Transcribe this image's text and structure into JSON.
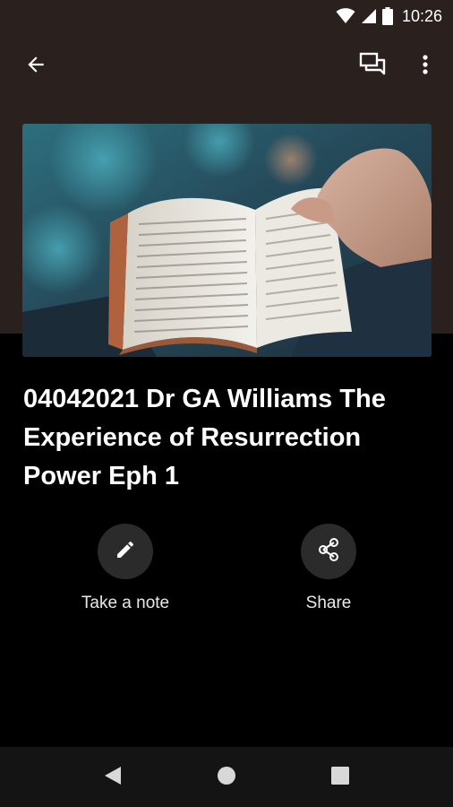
{
  "status_bar": {
    "time": "10:26",
    "icons": [
      "wifi-icon",
      "cellular-signal-icon",
      "battery-icon"
    ]
  },
  "toolbar": {
    "back_icon": "arrow-back-icon",
    "chat_icon": "chat-bubbles-icon",
    "more_icon": "more-vert-icon"
  },
  "episode": {
    "title": "04042021 Dr GA Williams The Experience of Resurrection Power Eph 1",
    "artwork_description_icon": "open-bible-artwork"
  },
  "actions": [
    {
      "label": "Take a note",
      "icon": "pencil-icon"
    },
    {
      "label": "Share",
      "icon": "share-icon"
    }
  ],
  "nav_bar": {
    "icons": [
      "nav-back-icon",
      "nav-home-icon",
      "nav-recents-icon"
    ]
  },
  "colors": {
    "header_background": "#2a201d",
    "page_background": "#000000",
    "action_circle": "#2b2b2b",
    "nav_background": "#141414",
    "text": "#ffffff"
  }
}
